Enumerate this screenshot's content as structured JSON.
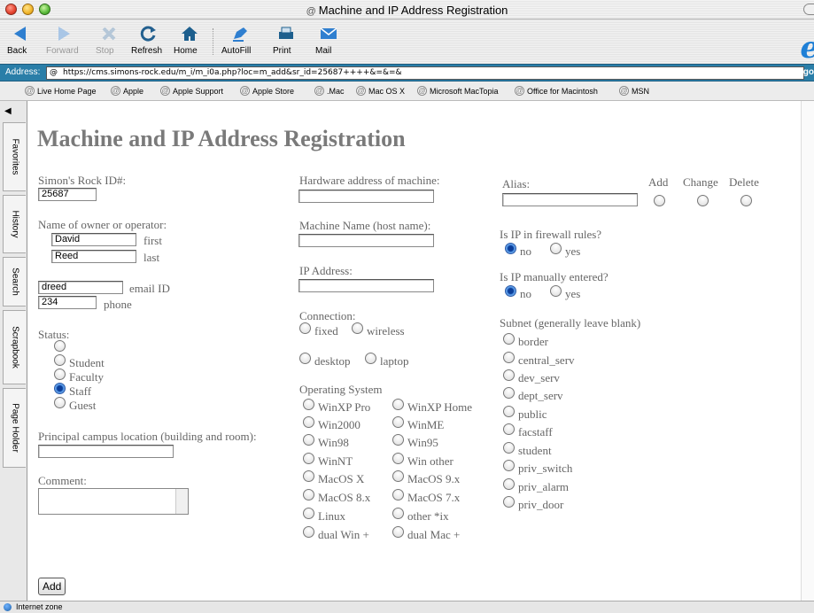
{
  "window": {
    "title": "Machine and IP Address Registration"
  },
  "toolbar": {
    "back": "Back",
    "forward": "Forward",
    "stop": "Stop",
    "refresh": "Refresh",
    "home": "Home",
    "autofill": "AutoFill",
    "print": "Print",
    "mail": "Mail"
  },
  "address": {
    "label": "Address:",
    "url": "https://cms.simons-rock.edu/m_i/m_i0a.php?loc=m_add&sr_id=25687++++&=&=&",
    "go": "go"
  },
  "favorites": [
    "Live Home Page",
    "Apple",
    "Apple Support",
    "Apple Store",
    ".Mac",
    "Mac OS X",
    "Microsoft MacTopia",
    "Office for Macintosh",
    "MSN"
  ],
  "sidebar": {
    "tabs": [
      "Favorites",
      "History",
      "Search",
      "Scrapbook",
      "Page Holder"
    ]
  },
  "page": {
    "heading": "Machine and IP Address Registration",
    "id_label": "Simon's Rock ID#:",
    "id_value": "25687",
    "owner_label": "Name of owner or operator:",
    "first_value": "David",
    "first_suffix": "first",
    "last_value": "Reed",
    "last_suffix": "last",
    "email_value": "dreed",
    "email_suffix": "email ID",
    "phone_value": "234",
    "phone_suffix": "phone",
    "status_label": "Status:",
    "status_options": [
      "Student",
      "Faculty",
      "Staff",
      "Guest"
    ],
    "status_selected": "Staff",
    "location_label": "Principal campus location (building and room):",
    "comment_label": "Comment:",
    "add_button": "Add",
    "hw_label": "Hardware address of machine:",
    "host_label": "Machine Name (host name):",
    "ip_label": "IP Address:",
    "connection_label": "Connection:",
    "conn_fixed": "fixed",
    "conn_wireless": "wireless",
    "conn_desktop": "desktop",
    "conn_laptop": "laptop",
    "os_label": "Operating System",
    "os_left": [
      "WinXP Pro",
      "Win2000",
      "Win98",
      "WinNT",
      "MacOS X",
      "MacOS 8.x",
      "Linux",
      "dual Win +"
    ],
    "os_right": [
      "WinXP Home",
      "WinME",
      "Win95",
      "Win other",
      "MacOS 9.x",
      "MacOS 7.x",
      "other *ix",
      "dual Mac +"
    ],
    "alias_label": "Alias:",
    "alias_add": "Add",
    "alias_change": "Change",
    "alias_delete": "Delete",
    "firewall_label": "Is IP in firewall rules?",
    "manual_label": "Is IP manually entered?",
    "no": "no",
    "yes": "yes",
    "subnet_label": "Subnet (generally leave blank)",
    "subnets": [
      "border",
      "central_serv",
      "dev_serv",
      "dept_serv",
      "public",
      "facstaff",
      "student",
      "priv_switch",
      "priv_alarm",
      "priv_door"
    ]
  },
  "status_bar": {
    "text": "Internet zone"
  },
  "colors": {
    "address_bar": "#2a7ea8",
    "radio_selected": "#2b5aa8",
    "page_text": "#666666"
  }
}
